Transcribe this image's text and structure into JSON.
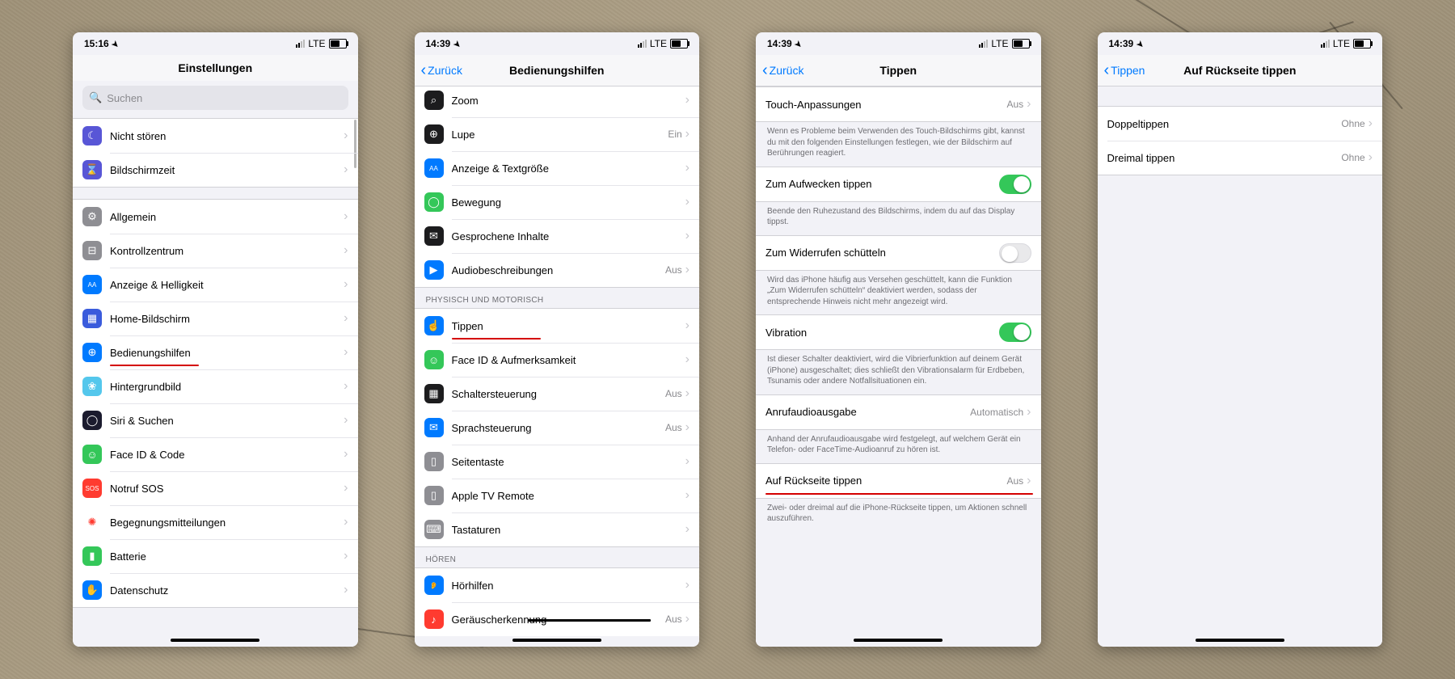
{
  "screens": {
    "s1": {
      "time": "15:16",
      "net": "LTE",
      "title": "Einstellungen",
      "search_placeholder": "Suchen",
      "g1": [
        {
          "key": "dnd",
          "label": "Nicht stören",
          "bg": "#5856d6",
          "glyph": "☾"
        },
        {
          "key": "screentime",
          "label": "Bildschirmzeit",
          "bg": "#5856d6",
          "glyph": "⌛"
        }
      ],
      "g2": [
        {
          "key": "general",
          "label": "Allgemein",
          "bg": "#8e8e93",
          "glyph": "⚙"
        },
        {
          "key": "controlcenter",
          "label": "Kontrollzentrum",
          "bg": "#8e8e93",
          "glyph": "⊟"
        },
        {
          "key": "display",
          "label": "Anzeige & Helligkeit",
          "bg": "#007aff",
          "glyph": "AA"
        },
        {
          "key": "home",
          "label": "Home-Bildschirm",
          "bg": "#3a5bdc",
          "glyph": "▦"
        },
        {
          "key": "accessibility",
          "label": "Bedienungshilfen",
          "bg": "#007aff",
          "glyph": "⊕",
          "underline": true
        },
        {
          "key": "wallpaper",
          "label": "Hintergrundbild",
          "bg": "#54c7ec",
          "glyph": "❀"
        },
        {
          "key": "siri",
          "label": "Siri & Suchen",
          "bg": "#1b1b2e",
          "glyph": "◯"
        },
        {
          "key": "faceid",
          "label": "Face ID & Code",
          "bg": "#34c759",
          "glyph": "☺"
        },
        {
          "key": "sos",
          "label": "Notruf SOS",
          "bg": "#ff3b30",
          "glyph": "SOS"
        },
        {
          "key": "exposure",
          "label": "Begegnungsmitteilungen",
          "bg": "#ffffff",
          "glyph": "✺",
          "fg": "#ff3b30"
        },
        {
          "key": "battery",
          "label": "Batterie",
          "bg": "#34c759",
          "glyph": "▮"
        },
        {
          "key": "privacy",
          "label": "Datenschutz",
          "bg": "#007aff",
          "glyph": "✋"
        }
      ]
    },
    "s2": {
      "time": "14:39",
      "net": "LTE",
      "back": "Zurück",
      "title": "Bedienungshilfen",
      "top_items": [
        {
          "key": "zoom",
          "label": "Zoom",
          "bg": "#1c1c1e",
          "glyph": "⌕",
          "val": ""
        },
        {
          "key": "magnifier",
          "label": "Lupe",
          "bg": "#1c1c1e",
          "glyph": "⊕",
          "val": "Ein"
        },
        {
          "key": "displaytext",
          "label": "Anzeige & Textgröße",
          "bg": "#007aff",
          "glyph": "AA",
          "val": ""
        },
        {
          "key": "motion",
          "label": "Bewegung",
          "bg": "#34c759",
          "glyph": "◯",
          "val": ""
        },
        {
          "key": "spoken",
          "label": "Gesprochene Inhalte",
          "bg": "#1c1c1e",
          "glyph": "✉",
          "val": ""
        },
        {
          "key": "audiodesc",
          "label": "Audiobeschreibungen",
          "bg": "#007aff",
          "glyph": "▶",
          "val": "Aus"
        }
      ],
      "section_physical": "PHYSISCH UND MOTORISCH",
      "physical": [
        {
          "key": "touch",
          "label": "Tippen",
          "bg": "#007aff",
          "glyph": "☝",
          "val": "",
          "underline": true
        },
        {
          "key": "faceatt",
          "label": "Face ID & Aufmerksamkeit",
          "bg": "#34c759",
          "glyph": "☺",
          "val": ""
        },
        {
          "key": "switchctrl",
          "label": "Schaltersteuerung",
          "bg": "#1c1c1e",
          "glyph": "▦",
          "val": "Aus"
        },
        {
          "key": "voicectrl",
          "label": "Sprachsteuerung",
          "bg": "#007aff",
          "glyph": "✉",
          "val": "Aus"
        },
        {
          "key": "sidebutton",
          "label": "Seitentaste",
          "bg": "#8e8e93",
          "glyph": "▯",
          "val": ""
        },
        {
          "key": "appletv",
          "label": "Apple TV Remote",
          "bg": "#8e8e93",
          "glyph": "▯",
          "val": ""
        },
        {
          "key": "keyboards",
          "label": "Tastaturen",
          "bg": "#8e8e93",
          "glyph": "⌨",
          "val": ""
        }
      ],
      "section_hearing": "HÖREN",
      "hearing": [
        {
          "key": "hearingaids",
          "label": "Hörhilfen",
          "bg": "#007aff",
          "glyph": "👂",
          "val": ""
        },
        {
          "key": "soundrec",
          "label": "Geräuscherkennung",
          "bg": "#ff3b30",
          "glyph": "♪",
          "val": "Aus",
          "strike": true
        }
      ]
    },
    "s3": {
      "time": "14:39",
      "net": "LTE",
      "back": "Zurück",
      "title": "Tippen",
      "r_touchacc": {
        "label": "Touch-Anpassungen",
        "val": "Aus"
      },
      "f_touchacc": "Wenn es Probleme beim Verwenden des Touch-Bildschirms gibt, kannst du mit den folgenden Einstellungen festlegen, wie der Bildschirm auf Berührungen reagiert.",
      "r_tapwake": {
        "label": "Zum Aufwecken tippen",
        "on": true
      },
      "f_tapwake": "Beende den Ruhezustand des Bildschirms, indem du auf das Display tippst.",
      "r_shake": {
        "label": "Zum Widerrufen schütteln",
        "on": false
      },
      "f_shake": "Wird das iPhone häufig aus Versehen geschüttelt, kann die Funktion „Zum Widerrufen schütteln“ deaktiviert werden, sodass der entsprechende Hinweis nicht mehr angezeigt wird.",
      "r_vibration": {
        "label": "Vibration",
        "on": true
      },
      "f_vibration": "Ist dieser Schalter deaktiviert, wird die Vibrierfunktion auf deinem Gerät (iPhone) ausgeschaltet; dies schließt den Vibrationsalarm für Erdbeben, Tsunamis oder andere Notfallsituationen ein.",
      "r_callaudio": {
        "label": "Anrufaudioausgabe",
        "val": "Automatisch"
      },
      "f_callaudio": "Anhand der Anrufaudioausgabe wird festgelegt, auf welchem Gerät ein Telefon- oder FaceTime-Audioanruf zu hören ist.",
      "r_backtap": {
        "label": "Auf Rückseite tippen",
        "val": "Aus",
        "underline": true
      },
      "f_backtap": "Zwei- oder dreimal auf die iPhone-Rückseite tippen, um Aktionen schnell auszuführen."
    },
    "s4": {
      "time": "14:39",
      "net": "LTE",
      "back": "Tippen",
      "title": "Auf Rückseite tippen",
      "rows": [
        {
          "key": "double",
          "label": "Doppeltippen",
          "val": "Ohne"
        },
        {
          "key": "triple",
          "label": "Dreimal tippen",
          "val": "Ohne"
        }
      ]
    }
  }
}
